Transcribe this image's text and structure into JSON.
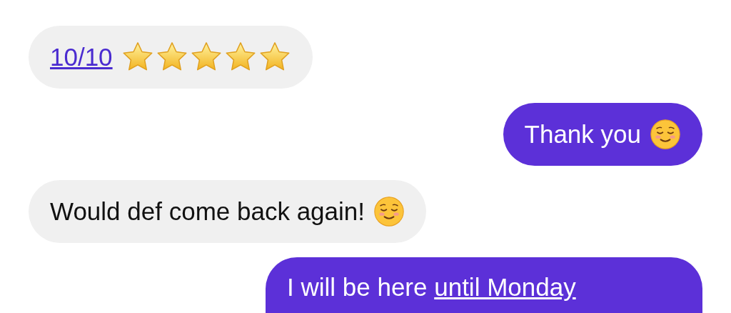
{
  "messages": [
    {
      "outgoing": false,
      "link": "10/10",
      "stars": 5
    },
    {
      "outgoing": true,
      "text": "Thank you",
      "emoji": true
    },
    {
      "outgoing": false,
      "text": "Would def come back again!",
      "emoji": true
    },
    {
      "outgoing": true,
      "text": "I will be here",
      "link": "until Monday"
    }
  ]
}
